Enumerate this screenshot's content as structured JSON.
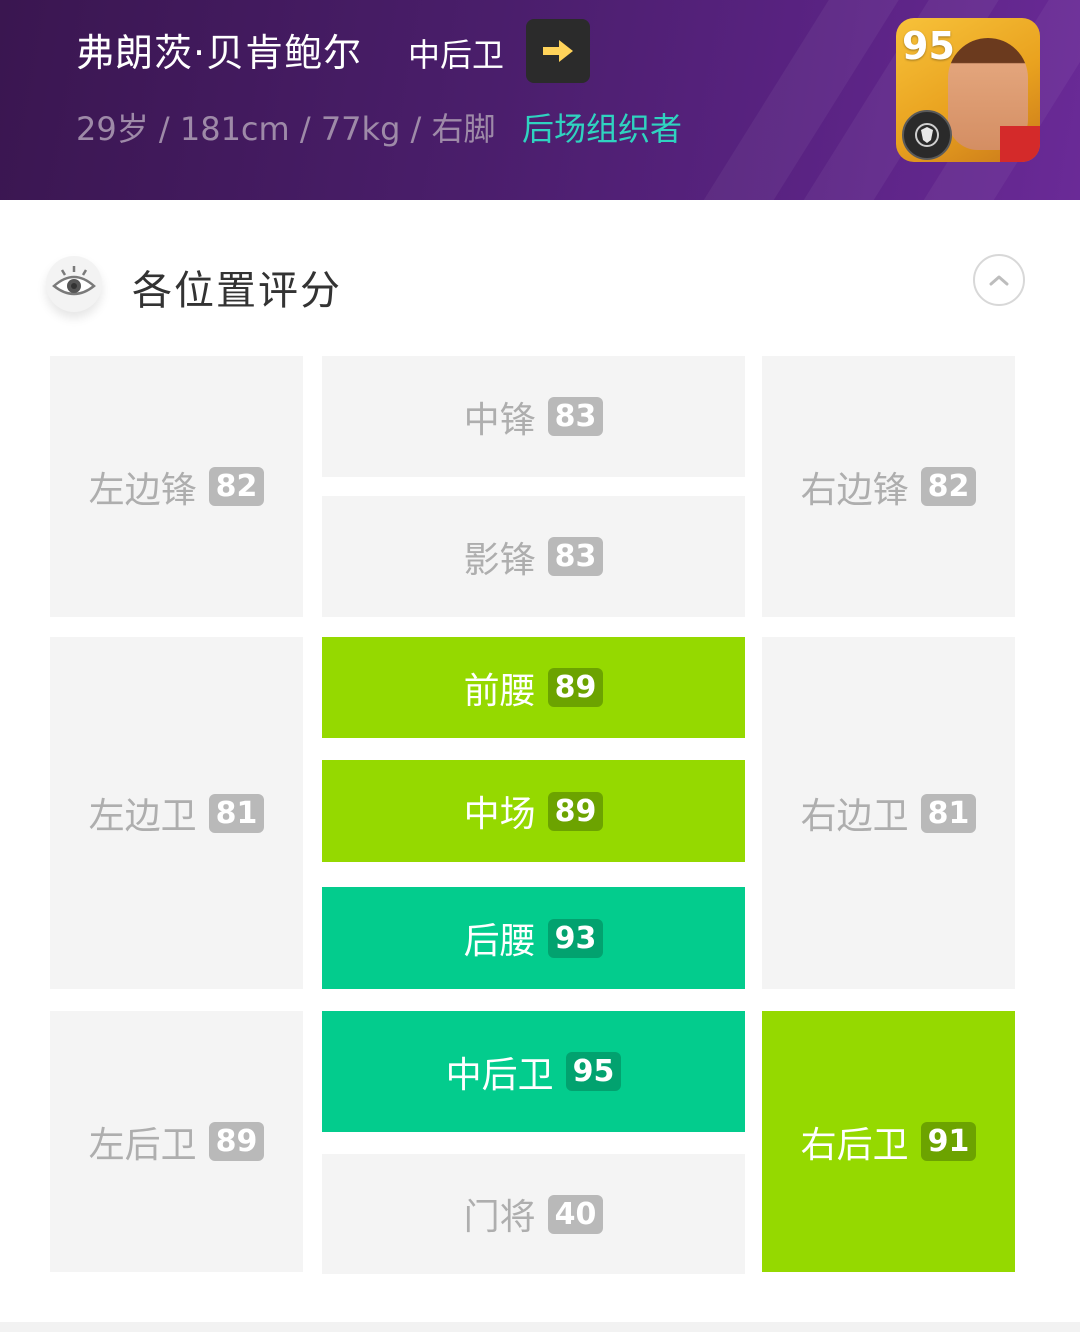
{
  "player": {
    "name": "弗朗茨·贝肯鲍尔",
    "position": "中后卫",
    "info": "29岁 / 181cm / 77kg / 右脚",
    "style": "后场组织者",
    "card_rating": "95"
  },
  "section": {
    "title": "各位置评分"
  },
  "positions": {
    "lwf": {
      "label": "左边锋",
      "score": "82"
    },
    "cf": {
      "label": "中锋",
      "score": "83"
    },
    "rwf": {
      "label": "右边锋",
      "score": "82"
    },
    "ss": {
      "label": "影锋",
      "score": "83"
    },
    "amf": {
      "label": "前腰",
      "score": "89"
    },
    "lmf": {
      "label": "左边卫",
      "score": "81"
    },
    "cmf": {
      "label": "中场",
      "score": "89"
    },
    "rmf": {
      "label": "右边卫",
      "score": "81"
    },
    "dmf": {
      "label": "后腰",
      "score": "93"
    },
    "lb": {
      "label": "左后卫",
      "score": "89"
    },
    "cb": {
      "label": "中后卫",
      "score": "95"
    },
    "rb": {
      "label": "右后卫",
      "score": "91"
    },
    "gk": {
      "label": "门将",
      "score": "40"
    }
  },
  "colors": {
    "header": "#4a1e6b",
    "style_text": "#2fd3c0",
    "tile_default": "#f4f4f4",
    "tile_lime": "#95d900",
    "tile_teal": "#03cc8d"
  }
}
